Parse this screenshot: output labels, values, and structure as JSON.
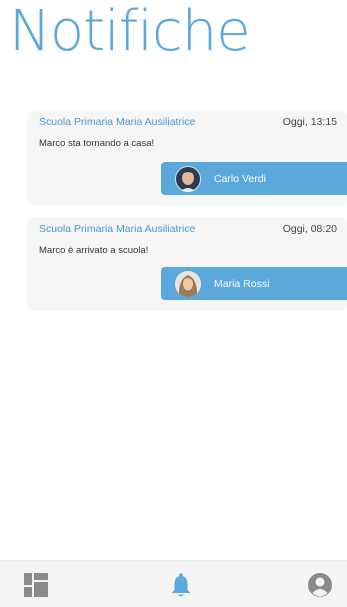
{
  "header": {
    "title": "Notifiche"
  },
  "notifications": [
    {
      "sender": "Scuola Primaria Maria Ausiliatrice",
      "time": "Oggi, 13:15",
      "message": "Marco sta tornando a casa!",
      "person": {
        "name": "Carlo Verdi",
        "avatar_icon": "male-avatar-icon"
      }
    },
    {
      "sender": "Scuola Primaria Maria Ausiliatrice",
      "time": "Oggi, 08:20",
      "message": "Marco è arrivato a scuola!",
      "person": {
        "name": "Maria Rossi",
        "avatar_icon": "female-avatar-icon"
      }
    }
  ],
  "tabbar": {
    "items": [
      {
        "icon": "dashboard-icon",
        "active": false
      },
      {
        "icon": "bell-icon",
        "active": true
      },
      {
        "icon": "user-circle-icon",
        "active": false
      }
    ]
  },
  "colors": {
    "accent": "#5aa8dc",
    "card_background": "#f6f6f6",
    "inactive_icon": "#8a8a8a"
  }
}
